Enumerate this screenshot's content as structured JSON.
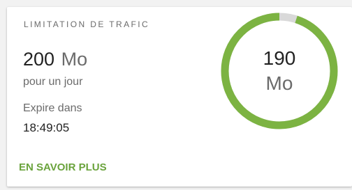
{
  "card": {
    "title": "LIMITATION DE TRAFIC",
    "quota_value": "200",
    "quota_unit": "Mo",
    "period": "pour un jour",
    "expire_label": "Expire dans",
    "expire_time": "18:49:05",
    "more_link": "EN SAVOIR PLUS"
  },
  "gauge": {
    "remaining_value": "190",
    "remaining_unit": "Mo",
    "remaining": 190,
    "total": 200,
    "colors": {
      "remaining": "#7cb342",
      "used": "#d9d9d9"
    }
  },
  "theme": {
    "accent": "#6aa33c"
  }
}
